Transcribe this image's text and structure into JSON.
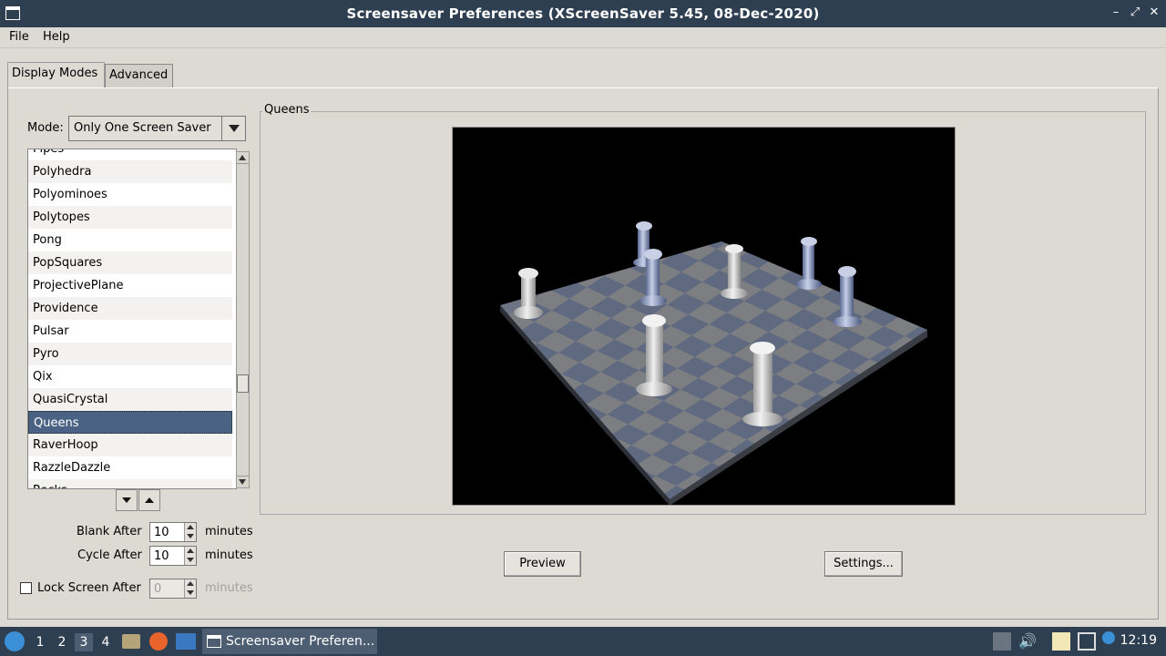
{
  "window": {
    "title": "Screensaver Preferences  (XScreenSaver 5.45, 08-Dec-2020)"
  },
  "menu": [
    "File",
    "Help"
  ],
  "tabs": [
    "Display Modes",
    "Advanced"
  ],
  "mode": {
    "label": "Mode:",
    "value": "Only One Screen Saver"
  },
  "list": {
    "items": [
      "Pipes",
      "Polyhedra",
      "Polyominoes",
      "Polytopes",
      "Pong",
      "PopSquares",
      "ProjectivePlane",
      "Providence",
      "Pulsar",
      "Pyro",
      "Qix",
      "QuasiCrystal",
      "Queens",
      "RaverHoop",
      "RazzleDazzle",
      "Rocks"
    ],
    "selected": "Queens"
  },
  "timing": {
    "blank_label": "Blank After",
    "blank_value": "10",
    "cycle_label": "Cycle After",
    "cycle_value": "10",
    "lock_label": "Lock Screen After",
    "lock_value": "0",
    "unit": "minutes"
  },
  "preview": {
    "group_title": "Queens",
    "preview_button": "Preview",
    "settings_button": "Settings..."
  },
  "taskbar": {
    "workspaces": [
      "1",
      "2",
      "3",
      "4"
    ],
    "current_workspace": "3",
    "task_title": "Screensaver Preferen...",
    "clock": "12:19"
  },
  "colors": {
    "titlebar": "#2e3f52",
    "selection": "#4a6384",
    "background": "#ddd9d3"
  }
}
